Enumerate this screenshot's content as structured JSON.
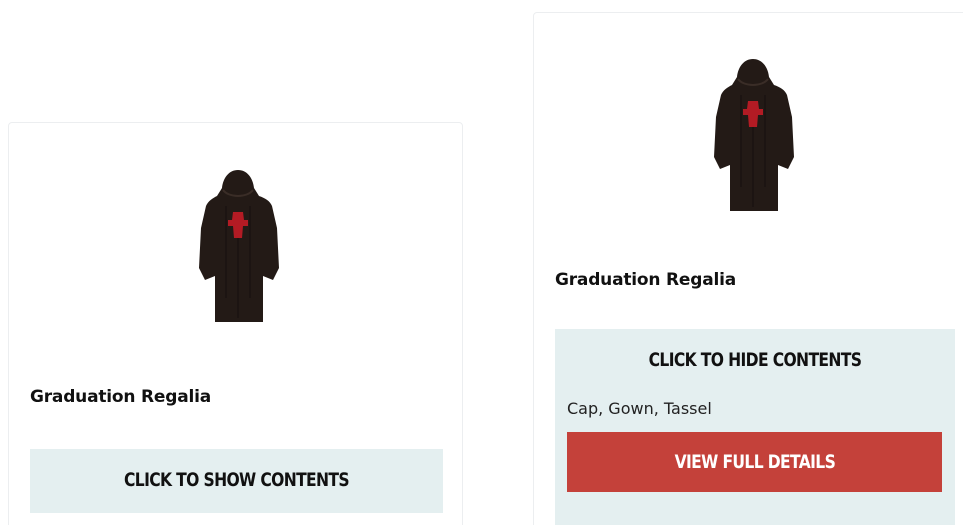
{
  "colors": {
    "panel_bg": "#e4eff0",
    "accent_button": "#c4413a",
    "gown": "#231a16",
    "gown_emblem": "#b31b24"
  },
  "products": [
    {
      "image_icon": "graduation-gown-icon",
      "title": "Graduation Regalia",
      "toggle_label": "CLICK TO SHOW CONTENTS",
      "expanded": false
    },
    {
      "image_icon": "graduation-gown-icon",
      "title": "Graduation Regalia",
      "toggle_label": "CLICK TO HIDE CONTENTS",
      "expanded": true,
      "contents": "Cap, Gown, Tassel",
      "details_label": "VIEW FULL DETAILS"
    }
  ]
}
